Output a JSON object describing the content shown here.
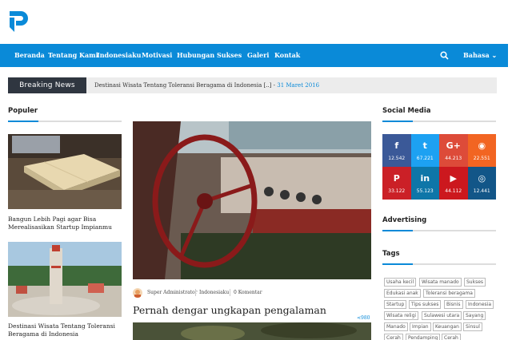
{
  "nav": {
    "items": [
      "Beranda",
      "Tentang Kami",
      "Indonesiaku",
      "Motivasi",
      "Hubungan",
      "Sukses",
      "Galeri",
      "Kontak"
    ],
    "language": "Bahasa"
  },
  "breaking": {
    "label": "Breaking News",
    "text": "Destinasi Wisata Tentang Toleransi Beragama di Indonesia [..] - ",
    "date": "31 Maret 2016"
  },
  "populer": {
    "title": "Populer",
    "items": [
      {
        "caption_line1": "Bangun Lebih Pagi agar Bisa",
        "caption_line2": "Merealisasikan Startup Impianmu"
      },
      {
        "caption_line1": "Destinasi Wisata Tentang Toleransi",
        "caption_line2": "Beragama di Indonesia"
      }
    ]
  },
  "article": {
    "author": "Super Administrator",
    "category": "Indonesiaku",
    "comments": "0 Komentar",
    "headline": "Pernah dengar ungkapan pengalaman",
    "shares": "980"
  },
  "social": {
    "title": "Social Media",
    "items": [
      {
        "icon": "f",
        "name": "facebook-icon",
        "count": "12.542",
        "color": "#3b5998"
      },
      {
        "icon": "t",
        "name": "twitter-icon",
        "count": "67.221",
        "color": "#1da1f2"
      },
      {
        "icon": "G+",
        "name": "google-plus-icon",
        "count": "44.213",
        "color": "#dd4b39"
      },
      {
        "icon": "◉",
        "name": "rss-icon",
        "count": "22.551",
        "color": "#f26522"
      },
      {
        "icon": "P",
        "name": "pinterest-icon",
        "count": "33.122",
        "color": "#cb2027"
      },
      {
        "icon": "in",
        "name": "linkedin-icon",
        "count": "55.123",
        "color": "#0e76a8"
      },
      {
        "icon": "▶",
        "name": "youtube-icon",
        "count": "44.112",
        "color": "#cc181e"
      },
      {
        "icon": "◎",
        "name": "instagram-icon",
        "count": "12.441",
        "color": "#125688"
      }
    ]
  },
  "advertising": {
    "title": "Advertising"
  },
  "tags": {
    "title": "Tags",
    "items": [
      "Usaha kecil",
      "Wisata manado",
      "Sukses",
      "Edukasi anak",
      "Toleransi beragama",
      "Startup",
      "Tips sukses",
      "Bisnis",
      "Indonesia",
      "Wisata religi",
      "Sulawesi utara",
      "Sayang",
      "Manado",
      "Impian",
      "Keuangan",
      "Sinsul",
      "Cerah",
      "Pendamping",
      "Cerah"
    ]
  },
  "colors": {
    "accent": "#0a8ad8",
    "breaking_dark": "#2f3640"
  }
}
